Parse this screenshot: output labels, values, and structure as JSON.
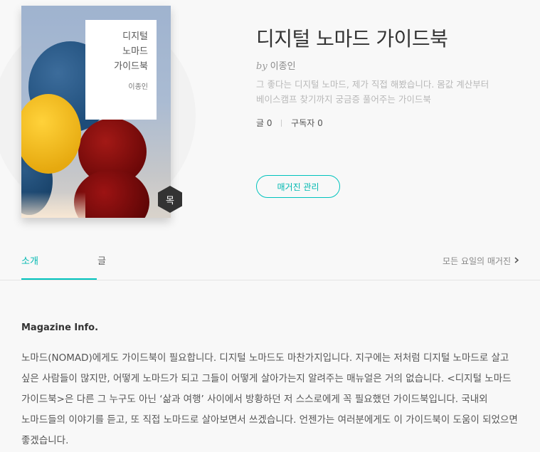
{
  "magazine": {
    "cover": {
      "title": "디지털 노마드 가이드북",
      "author": "이종인",
      "day_badge": "목"
    },
    "title": "디지털 노마드 가이드북",
    "by_prefix": "by",
    "author": "이종인",
    "description": "그 좋다는 디지털 노마드, 제가 직접 해봤습니다. 몸값 계산부터 베이스캠프 찾기까지 궁금증 풀어주는 가이드북",
    "stats": {
      "posts_label": "글",
      "posts_count": "0",
      "subscribers_label": "구독자",
      "subscribers_count": "0"
    },
    "manage_button": "매거진 관리"
  },
  "tabs": [
    {
      "label": "소개",
      "active": true
    },
    {
      "label": "글",
      "active": false
    }
  ],
  "all_days_link": "모든 요일의 매거진",
  "info": {
    "heading": "Magazine Info.",
    "body": "노마드(NOMAD)에게도 가이드북이 필요합니다. 디지털 노마드도 마찬가지입니다. 지구에는 저처럼 디지털 노마드로 살고 싶은 사람들이 많지만, 어떻게 노마드가 되고 그들이 어떻게 살아가는지 알려주는 매뉴얼은 거의 없습니다. <디지털 노마드 가이드북>은 다른 그 누구도 아닌 ‘삶과 여행’ 사이에서 방황하던 저 스스로에게 꼭 필요했던 가이드북입니다. 국내외 노마드들의 이야기를 듣고, 또 직접 노마드로 살아보면서 쓰겠습니다. 언젠가는 여러분에게도 이 가이드북이 도움이 되었으면 좋겠습니다."
  },
  "colors": {
    "accent": "#00c3bd",
    "background": "#f8f8f8"
  }
}
